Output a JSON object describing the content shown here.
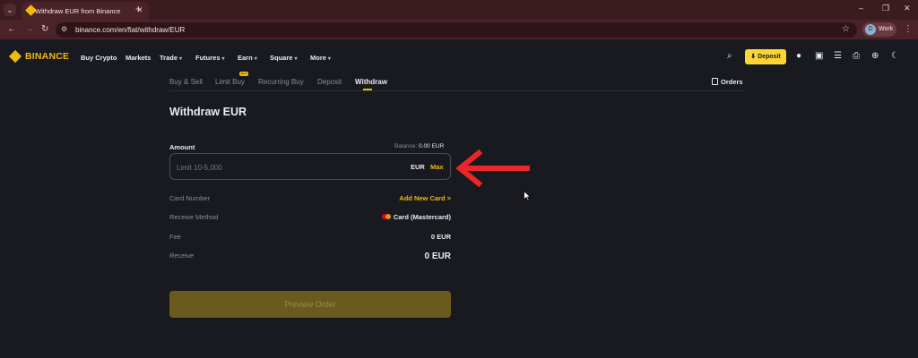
{
  "browser": {
    "tab_title": "Withdraw EUR from Binance",
    "tab_close": "✕",
    "new_tab": "+",
    "url": "binance.com/en/fiat/withdraw/EUR",
    "profile_initial": "D",
    "profile_label": "Work"
  },
  "header": {
    "logo_text": "BINANCE",
    "nav": [
      {
        "label": "Buy Crypto",
        "dropdown": false
      },
      {
        "label": "Markets",
        "dropdown": false
      },
      {
        "label": "Trade",
        "dropdown": true
      },
      {
        "label": "Futures",
        "dropdown": true
      },
      {
        "label": "Earn",
        "dropdown": true
      },
      {
        "label": "Square",
        "dropdown": true
      },
      {
        "label": "More",
        "dropdown": true
      }
    ],
    "deposit_label": "Deposit"
  },
  "subnav": {
    "tabs": [
      "Buy & Sell",
      "Limit Buy",
      "Recurring Buy",
      "Deposit",
      "Withdraw"
    ],
    "active_tab": "Withdraw",
    "badge": "New",
    "orders_label": "Orders"
  },
  "form": {
    "title": "Withdraw EUR",
    "amount_label": "Amount",
    "balance_label": "Balance:",
    "balance_value": "0.00 EUR",
    "amount_placeholder": "Limit 10-5,000",
    "amount_value": "",
    "currency": "EUR",
    "max_label": "Max",
    "rows": {
      "card_number_label": "Card Number",
      "card_number_value": "Add New Card >",
      "receive_method_label": "Receive Method",
      "receive_method_value": "Card (Mastercard)",
      "fee_label": "Fee",
      "fee_value": "0 EUR",
      "receive_label": "Receive",
      "receive_value": "0 EUR"
    },
    "preview_label": "Preview Order"
  },
  "colors": {
    "accent": "#f0b90b",
    "background": "#181a20",
    "annotation_arrow": "#e8262c"
  }
}
